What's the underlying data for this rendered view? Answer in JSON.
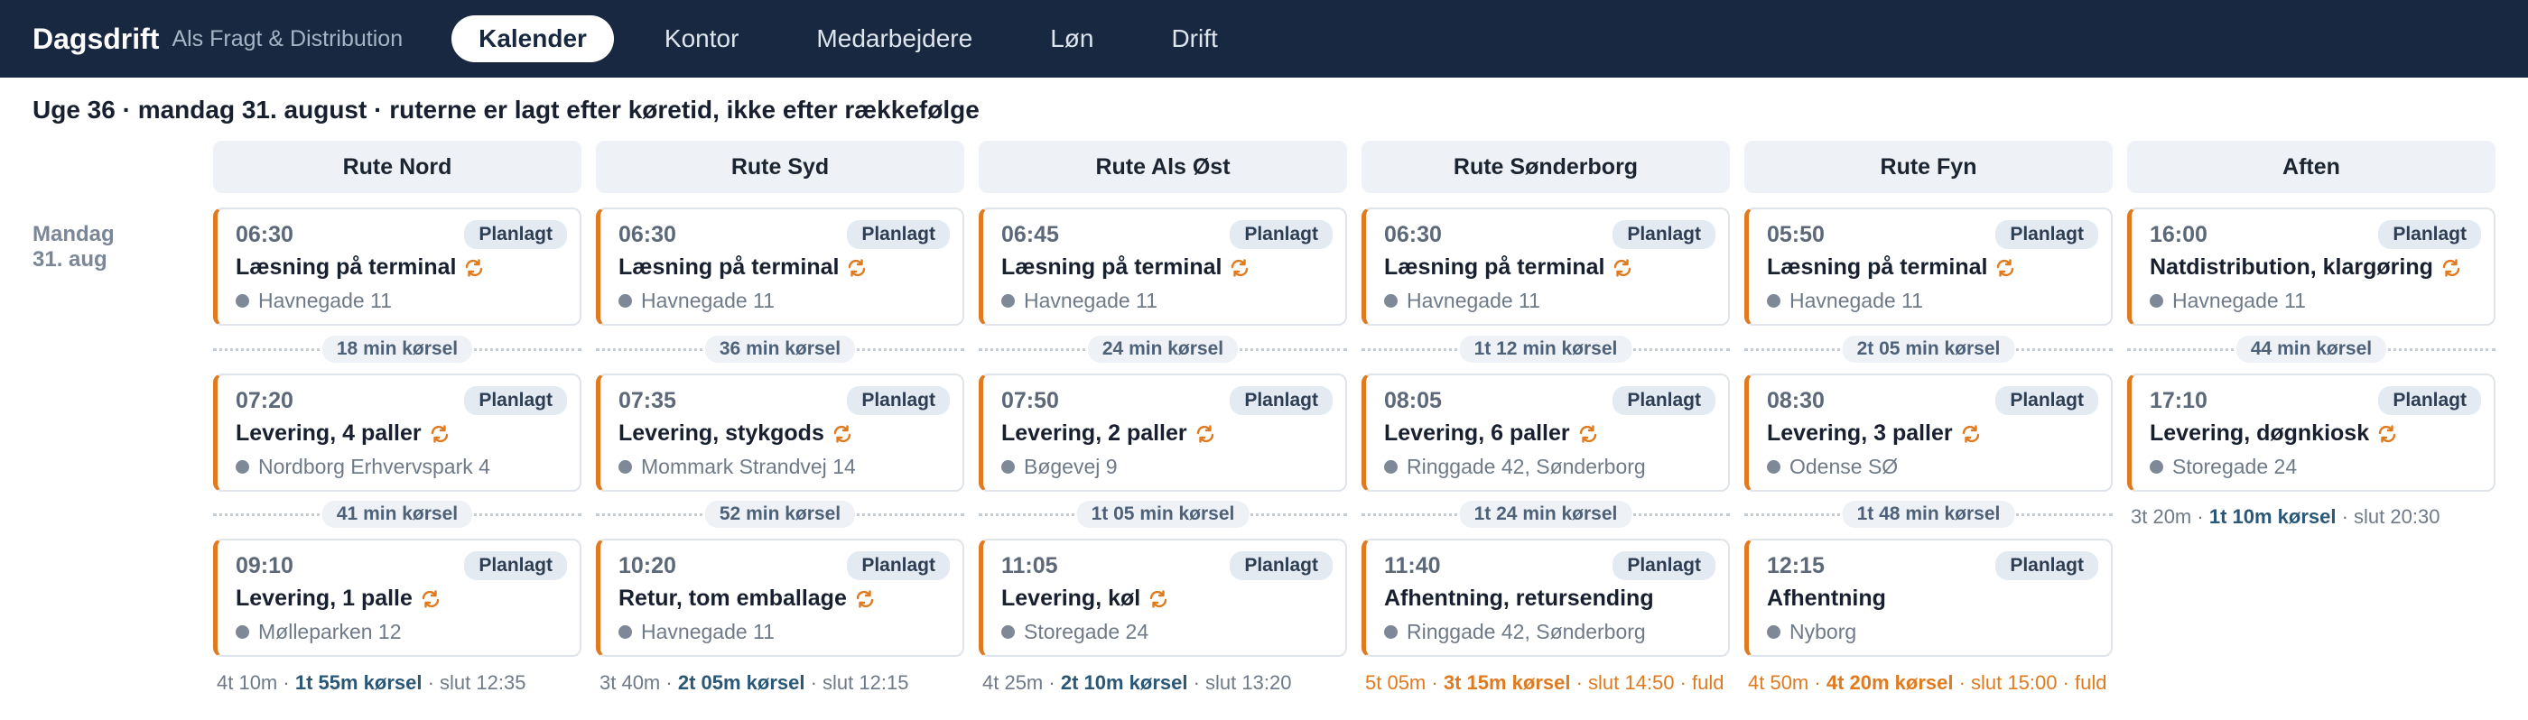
{
  "header": {
    "brand": "Dagsdrift",
    "company": "Als Fragt & Distribution",
    "nav": [
      {
        "label": "Kalender",
        "active": true
      },
      {
        "label": "Kontor",
        "active": false
      },
      {
        "label": "Medarbejdere",
        "active": false
      },
      {
        "label": "Løn",
        "active": false
      },
      {
        "label": "Drift",
        "active": false
      }
    ]
  },
  "page_heading": "Uge 36 · mandag 31. august · ruterne er lagt efter køretid, ikke efter rækkefølge",
  "day": {
    "line1": "Mandag",
    "line2": "31. aug"
  },
  "colors": {
    "nav_bg": "#182840",
    "accent": "#e07a1f",
    "badge_bg": "#e4eaf2",
    "link": "#2b5777"
  },
  "routes": [
    {
      "name": "Rute Nord",
      "stops": [
        {
          "time": "06:30",
          "status": "Planlagt",
          "title": "Læsning på terminal",
          "recurring": true,
          "address": "Havnegade 11"
        },
        {
          "time": "07:20",
          "status": "Planlagt",
          "title": "Levering, 4 paller",
          "recurring": true,
          "address": "Nordborg Erhvervspark 4"
        },
        {
          "time": "09:10",
          "status": "Planlagt",
          "title": "Levering, 1 palle",
          "recurring": true,
          "address": "Mølleparken 12"
        }
      ],
      "drives": [
        "18 min kørsel",
        "41 min kørsel"
      ],
      "summary": {
        "duration": "4t 10m",
        "sep1": " · ",
        "drive": "1t 55m kørsel",
        "sep2": " · ",
        "end": "slut 12:35",
        "full": "",
        "warn": false
      }
    },
    {
      "name": "Rute Syd",
      "stops": [
        {
          "time": "06:30",
          "status": "Planlagt",
          "title": "Læsning på terminal",
          "recurring": true,
          "address": "Havnegade 11"
        },
        {
          "time": "07:35",
          "status": "Planlagt",
          "title": "Levering, stykgods",
          "recurring": true,
          "address": "Mommark Strandvej 14"
        },
        {
          "time": "10:20",
          "status": "Planlagt",
          "title": "Retur, tom emballage",
          "recurring": true,
          "address": "Havnegade 11"
        }
      ],
      "drives": [
        "36 min kørsel",
        "52 min kørsel"
      ],
      "summary": {
        "duration": "3t 40m",
        "sep1": " · ",
        "drive": "2t 05m kørsel",
        "sep2": " · ",
        "end": "slut 12:15",
        "full": "",
        "warn": false
      }
    },
    {
      "name": "Rute Als Øst",
      "stops": [
        {
          "time": "06:45",
          "status": "Planlagt",
          "title": "Læsning på terminal",
          "recurring": true,
          "address": "Havnegade 11"
        },
        {
          "time": "07:50",
          "status": "Planlagt",
          "title": "Levering, 2 paller",
          "recurring": true,
          "address": "Bøgevej 9"
        },
        {
          "time": "11:05",
          "status": "Planlagt",
          "title": "Levering, køl",
          "recurring": true,
          "address": "Storegade 24"
        }
      ],
      "drives": [
        "24 min kørsel",
        "1t 05 min kørsel"
      ],
      "summary": {
        "duration": "4t 25m",
        "sep1": " · ",
        "drive": "2t 10m kørsel",
        "sep2": " · ",
        "end": "slut 13:20",
        "full": "",
        "warn": false
      }
    },
    {
      "name": "Rute Sønderborg",
      "stops": [
        {
          "time": "06:30",
          "status": "Planlagt",
          "title": "Læsning på terminal",
          "recurring": true,
          "address": "Havnegade 11"
        },
        {
          "time": "08:05",
          "status": "Planlagt",
          "title": "Levering, 6 paller",
          "recurring": true,
          "address": "Ringgade 42, Sønderborg"
        },
        {
          "time": "11:40",
          "status": "Planlagt",
          "title": "Afhentning, retursending",
          "recurring": false,
          "address": "Ringgade 42, Sønderborg"
        }
      ],
      "drives": [
        "1t 12 min kørsel",
        "1t 24 min kørsel"
      ],
      "summary": {
        "duration": "5t 05m",
        "sep1": " · ",
        "drive": "3t 15m kørsel",
        "sep2": " · ",
        "end": "slut 14:50",
        "full": " · fuld",
        "warn": true
      }
    },
    {
      "name": "Rute Fyn",
      "stops": [
        {
          "time": "05:50",
          "status": "Planlagt",
          "title": "Læsning på terminal",
          "recurring": true,
          "address": "Havnegade 11"
        },
        {
          "time": "08:30",
          "status": "Planlagt",
          "title": "Levering, 3 paller",
          "recurring": true,
          "address": "Odense SØ"
        },
        {
          "time": "12:15",
          "status": "Planlagt",
          "title": "Afhentning",
          "recurring": false,
          "address": "Nyborg"
        }
      ],
      "drives": [
        "2t 05 min kørsel",
        "1t 48 min kørsel"
      ],
      "summary": {
        "duration": "4t 50m",
        "sep1": " · ",
        "drive": "4t 20m kørsel",
        "sep2": " · ",
        "end": "slut 15:00",
        "full": " · fuld",
        "warn": true
      }
    },
    {
      "name": "Aften",
      "stops": [
        {
          "time": "16:00",
          "status": "Planlagt",
          "title": "Natdistribution, klargøring",
          "recurring": true,
          "address": "Havnegade 11"
        },
        {
          "time": "17:10",
          "status": "Planlagt",
          "title": "Levering, døgnkiosk",
          "recurring": true,
          "address": "Storegade 24"
        }
      ],
      "drives": [
        "44 min kørsel"
      ],
      "summary": {
        "duration": "3t 20m",
        "sep1": " · ",
        "drive": "1t 10m kørsel",
        "sep2": " · ",
        "end": "slut 20:30",
        "full": "",
        "warn": false
      }
    }
  ]
}
